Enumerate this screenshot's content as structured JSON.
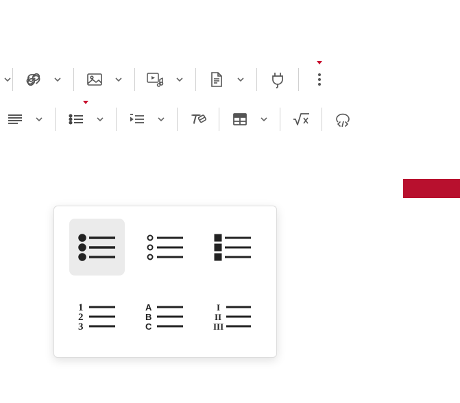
{
  "toolbar_row1": {
    "items": [
      {
        "name": "link",
        "has_dropdown": true
      },
      {
        "name": "image",
        "has_dropdown": true
      },
      {
        "name": "media",
        "has_dropdown": true
      },
      {
        "name": "document",
        "has_dropdown": true
      },
      {
        "name": "plugin",
        "has_dropdown": false
      },
      {
        "name": "more",
        "has_dropdown": false,
        "marker": true
      }
    ]
  },
  "toolbar_row2": {
    "items": [
      {
        "name": "align",
        "has_dropdown": true
      },
      {
        "name": "list",
        "has_dropdown": true,
        "open": true,
        "marker": true
      },
      {
        "name": "indent",
        "has_dropdown": true
      },
      {
        "name": "clear-format",
        "has_dropdown": false
      },
      {
        "name": "table",
        "has_dropdown": true
      },
      {
        "name": "equation",
        "has_dropdown": false
      },
      {
        "name": "code-block",
        "has_dropdown": false
      }
    ]
  },
  "list_dropdown": {
    "options": [
      {
        "name": "bullet-disc",
        "selected": true
      },
      {
        "name": "bullet-circle",
        "selected": false
      },
      {
        "name": "bullet-square",
        "selected": false
      },
      {
        "name": "numbered-123",
        "selected": false
      },
      {
        "name": "numbered-abc",
        "selected": false
      },
      {
        "name": "numbered-roman",
        "selected": false
      }
    ]
  },
  "colors": {
    "accent": "#c8102e",
    "icon": "#555555"
  }
}
